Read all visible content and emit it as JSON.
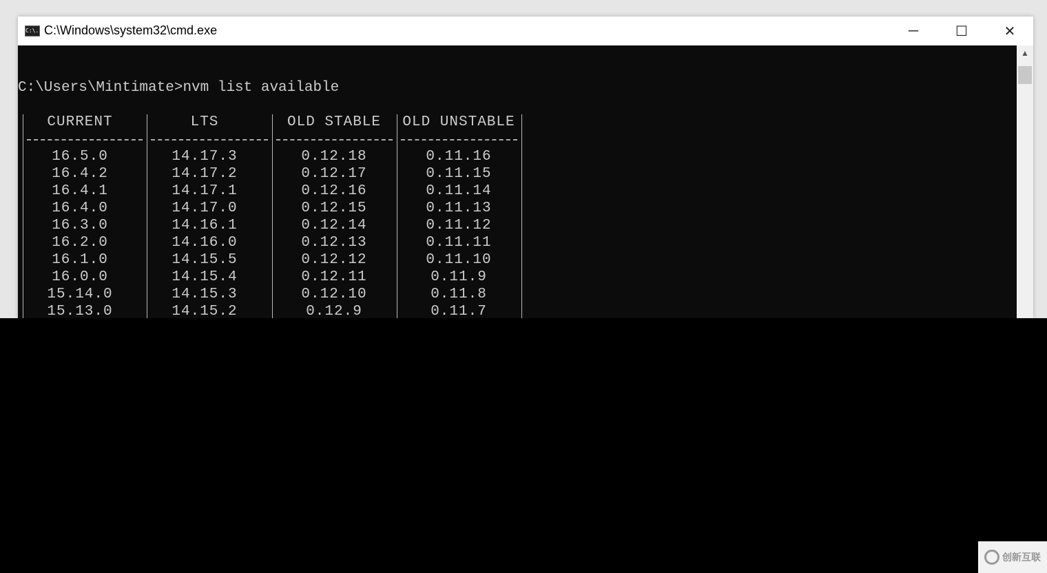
{
  "window": {
    "title": "C:\\Windows\\system32\\cmd.exe",
    "icon": "cmd-icon",
    "icon_text": "C:\\."
  },
  "controls": {
    "minimize": "─",
    "maximize": "☐",
    "close": "✕"
  },
  "terminal": {
    "prompt_line": "C:\\Users\\Mintimate>nvm list available",
    "headers": [
      "CURRENT",
      "LTS",
      "OLD STABLE",
      "OLD UNSTABLE"
    ],
    "rows": [
      [
        "16.5.0",
        "14.17.3",
        "0.12.18",
        "0.11.16"
      ],
      [
        "16.4.2",
        "14.17.2",
        "0.12.17",
        "0.11.15"
      ],
      [
        "16.4.1",
        "14.17.1",
        "0.12.16",
        "0.11.14"
      ],
      [
        "16.4.0",
        "14.17.0",
        "0.12.15",
        "0.11.13"
      ],
      [
        "16.3.0",
        "14.16.1",
        "0.12.14",
        "0.11.12"
      ],
      [
        "16.2.0",
        "14.16.0",
        "0.12.13",
        "0.11.11"
      ],
      [
        "16.1.0",
        "14.15.5",
        "0.12.12",
        "0.11.10"
      ],
      [
        "16.0.0",
        "14.15.4",
        "0.12.11",
        "0.11.9"
      ],
      [
        "15.14.0",
        "14.15.3",
        "0.12.10",
        "0.11.8"
      ],
      [
        "15.13.0",
        "14.15.2",
        "0.12.9",
        "0.11.7"
      ]
    ]
  },
  "watermark": {
    "text": "创新互联"
  }
}
